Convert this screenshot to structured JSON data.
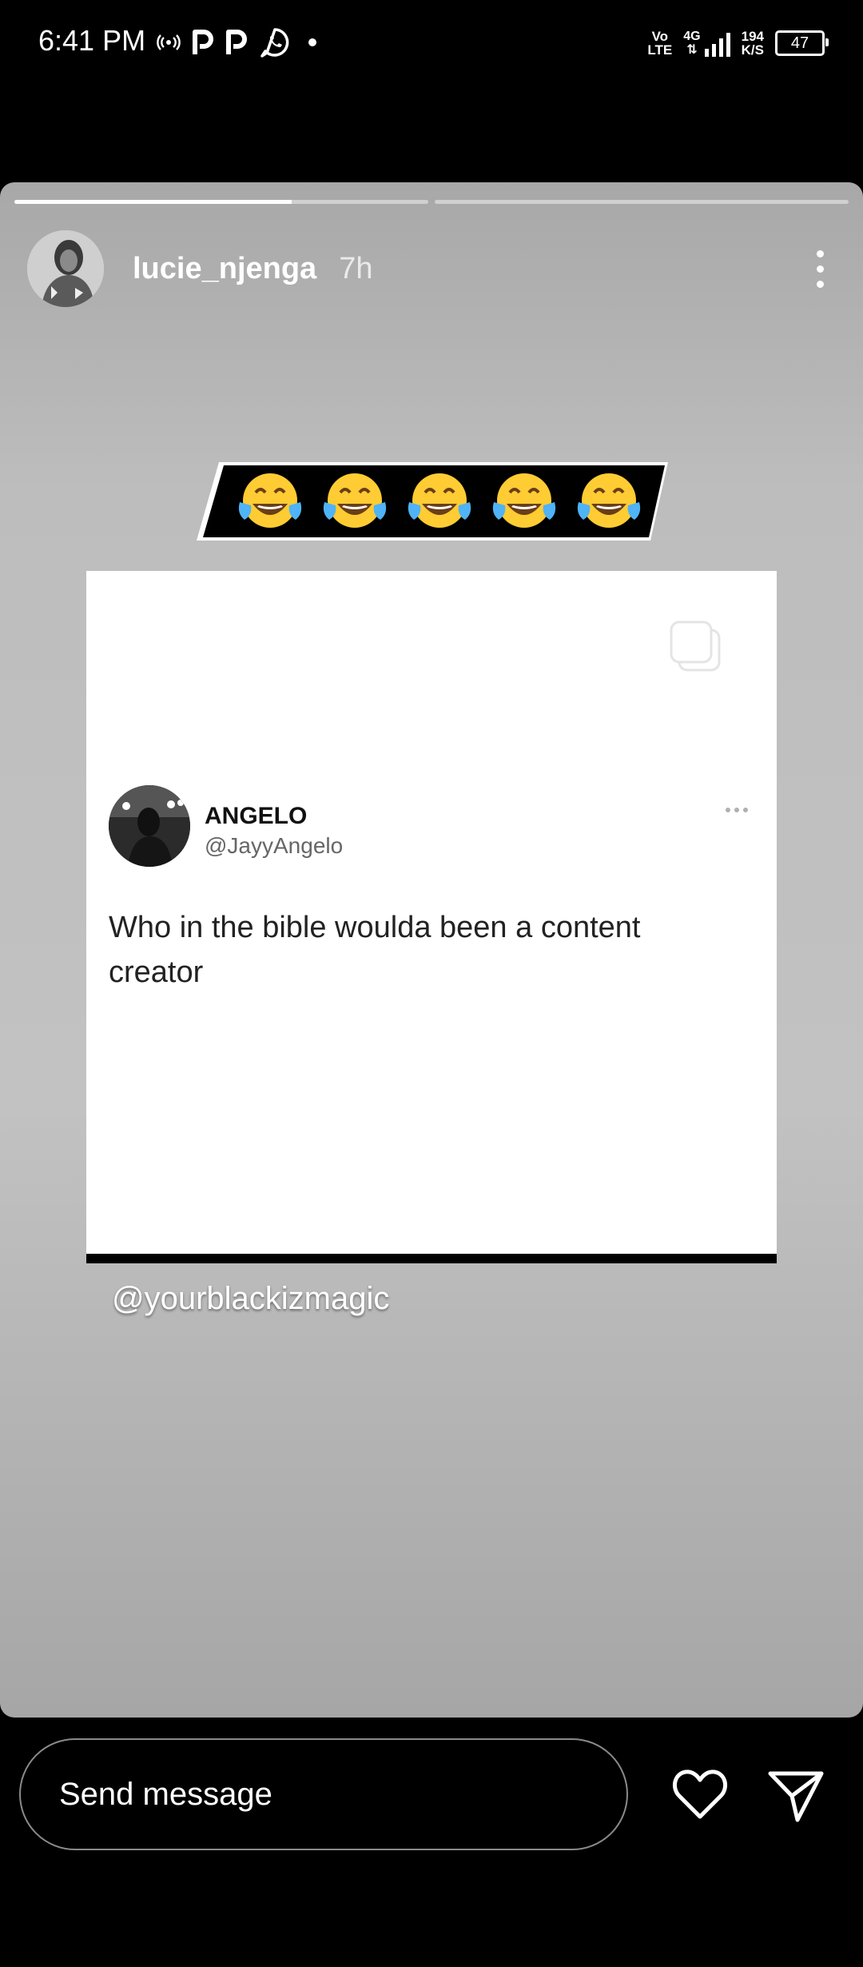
{
  "status_bar": {
    "time": "6:41 PM",
    "left_icons": [
      "hotspot-icon",
      "p-app-icon",
      "p-app-icon",
      "whatsapp-icon",
      "dot"
    ],
    "volte_top": "Vo",
    "volte_bottom": "LTE",
    "network": "4G",
    "speed_top": "194",
    "speed_bottom": "K/S",
    "battery": "47"
  },
  "story": {
    "username": "lucie_njenga",
    "time_ago": "7h",
    "progress": [
      0.67,
      0
    ],
    "emoji_banner": [
      "😂",
      "😂",
      "😂",
      "😂",
      "😂"
    ],
    "tweet": {
      "name": "ANGELO",
      "handle": "@JayyAngelo",
      "text": "Who in the bible woulda been a content creator"
    },
    "credit": "@yourblackizmagic"
  },
  "reply_bar": {
    "placeholder": "Send message"
  },
  "colors": {
    "background": "#000000",
    "story_gray": "#bdbdbd",
    "banner_black": "#000000"
  }
}
